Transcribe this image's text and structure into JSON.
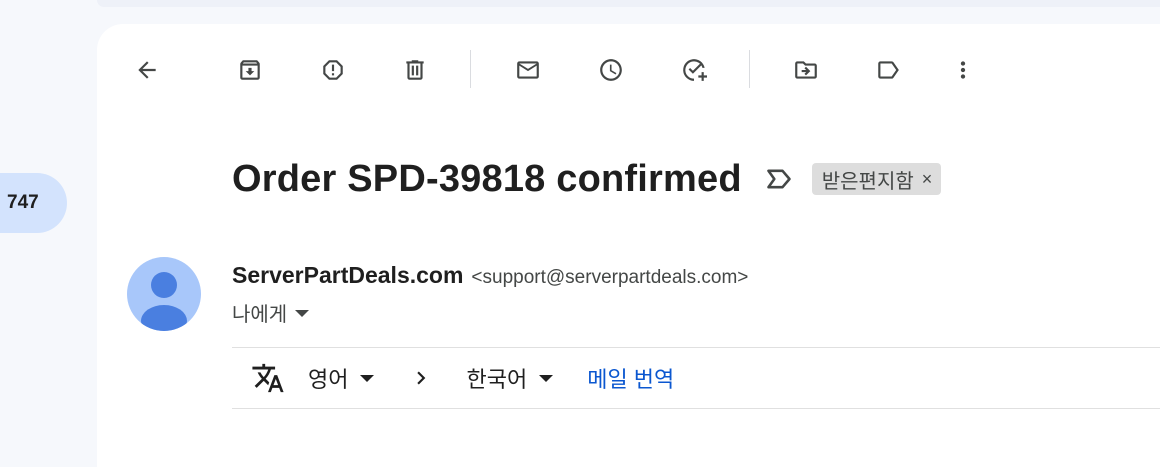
{
  "sidebar": {
    "inbox_count": "747"
  },
  "toolbar": {
    "buttons": [
      {
        "name": "back-button",
        "icon": "arrow-back-icon"
      },
      {
        "name": "archive-button",
        "icon": "archive-icon"
      },
      {
        "name": "report-spam-button",
        "icon": "report-icon"
      },
      {
        "name": "delete-button",
        "icon": "trash-icon"
      },
      {
        "name": "mark-unread-button",
        "icon": "mail-icon"
      },
      {
        "name": "snooze-button",
        "icon": "clock-icon"
      },
      {
        "name": "add-to-tasks-button",
        "icon": "task-add-icon"
      },
      {
        "name": "move-to-button",
        "icon": "folder-move-icon"
      },
      {
        "name": "labels-button",
        "icon": "label-icon"
      },
      {
        "name": "more-button",
        "icon": "more-vert-icon"
      }
    ]
  },
  "email": {
    "subject": "Order SPD-39818 confirmed",
    "label": "받은편지함",
    "label_remove": "×",
    "sender_name": "ServerPartDeals.com",
    "sender_email": "<support@serverpartdeals.com>",
    "recipient": "나에게"
  },
  "translate": {
    "source_lang": "영어",
    "target_lang": "한국어",
    "action": "메일 번역"
  },
  "colors": {
    "accent": "#0b57d0",
    "chip_bg": "#dddddd",
    "avatar_bg": "#a8c7fa",
    "avatar_fg": "#4a7fe0",
    "count_bg": "#d3e3fd"
  }
}
